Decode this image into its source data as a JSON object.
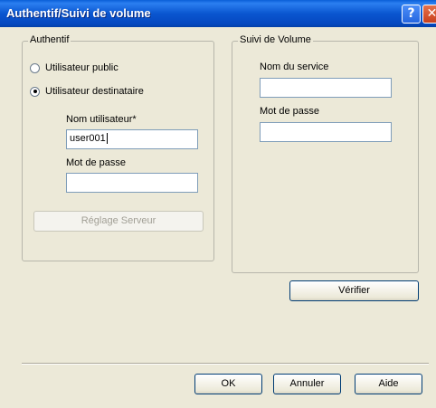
{
  "window": {
    "title": "Authentif/Suivi de volume",
    "help_glyph": "?",
    "close_glyph": "✕"
  },
  "auth": {
    "group_label": "Authentif",
    "radio_public": "Utilisateur public",
    "radio_dest": "Utilisateur destinataire",
    "selected": "Utilisateur destinataire",
    "username_label": "Nom utilisateur*",
    "username_value": "user001",
    "password_label": "Mot de passe",
    "password_value": "",
    "server_button": "Réglage Serveur"
  },
  "volume": {
    "group_label": "Suivi de Volume",
    "service_label": "Nom du service",
    "service_value": "",
    "password_label": "Mot de passe",
    "password_value": "",
    "verify_button": "Vérifier"
  },
  "footer": {
    "ok_button": "OK",
    "cancel_button": "Annuler",
    "help_button": "Aide"
  }
}
